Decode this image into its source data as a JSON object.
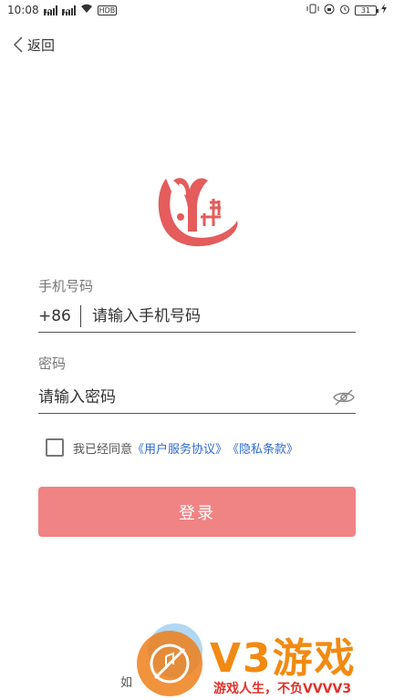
{
  "status_bar": {
    "time": "10:08",
    "sim1_label": "4G",
    "sim2_label": "4G",
    "hd_label": "HDB",
    "battery_level": "31"
  },
  "nav": {
    "back_label": "返回"
  },
  "colors": {
    "accent": "#f08383",
    "link": "#2e6bd1",
    "logo": "#e45c5c"
  },
  "form": {
    "phone_label": "手机号码",
    "country_code": "+86",
    "phone_placeholder": "请输入手机号码",
    "password_label": "密码",
    "password_placeholder": "请输入密码"
  },
  "agreement": {
    "prefix": "我已经同意",
    "user_agreement": "《用户服务协议》",
    "privacy_policy": "《隐私条款》"
  },
  "login_button_label": "登录",
  "bottom_partial_text": "如",
  "watermark": {
    "title": "V3游戏",
    "slogan": "游戏人生，不负VVVV3"
  }
}
